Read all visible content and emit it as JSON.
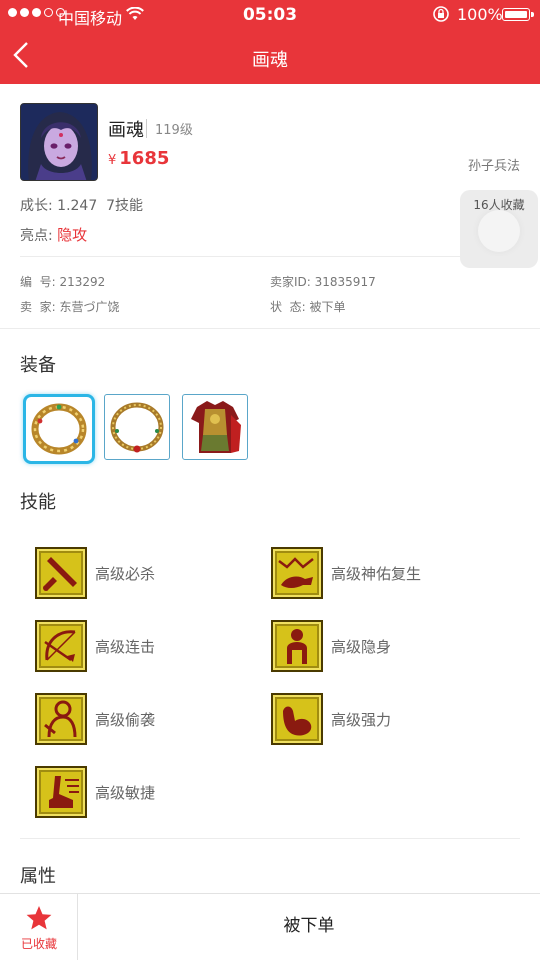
{
  "status_bar": {
    "carrier": "中国移动",
    "time": "05:03",
    "battery": "100%"
  },
  "nav": {
    "title": "画魂"
  },
  "character": {
    "name": "画魂",
    "level": "119级",
    "currency": "¥",
    "price": "1685",
    "school": "孙子兵法",
    "favorites": "16人收藏",
    "growth": "成长: 1.247  7技能",
    "highlight_label": "亮点: ",
    "highlight_value": "隐攻"
  },
  "info": {
    "id_label": "编  号: 213292",
    "seller_id_label": "卖家ID: 31835917",
    "seller_label": "卖  家: 东营づ广饶",
    "state_label": "状  态: 被下单"
  },
  "sections": {
    "equipment": "装备",
    "skills": "技能",
    "attributes": "属性"
  },
  "equipment": [
    {
      "name": "ring-icon"
    },
    {
      "name": "necklace-icon"
    },
    {
      "name": "armor-icon"
    }
  ],
  "skills": [
    {
      "label": "高级必杀",
      "icon": "sword-icon"
    },
    {
      "label": "高级神佑复生",
      "icon": "revive-icon"
    },
    {
      "label": "高级连击",
      "icon": "bow-icon"
    },
    {
      "label": "高级隐身",
      "icon": "stealth-icon"
    },
    {
      "label": "高级偷袭",
      "icon": "ambush-icon"
    },
    {
      "label": "高级强力",
      "icon": "strength-icon"
    },
    {
      "label": "高级敏捷",
      "icon": "agility-icon"
    }
  ],
  "bottom": {
    "favorited": "已收藏",
    "order": "被下单"
  },
  "colors": {
    "brand_red": "#e8353a",
    "skill_yellow": "#d6c21a",
    "equip_border": "#2bb6e6"
  }
}
